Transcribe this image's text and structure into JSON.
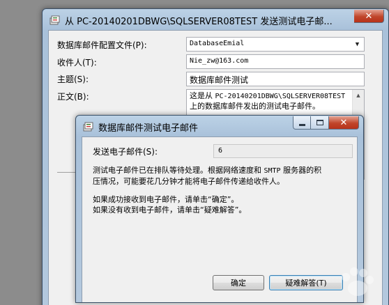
{
  "back_window": {
    "title": "从 PC-20140201DBWG\\SQLSERVER08TEST 发送测试电子邮...",
    "profile_label": "数据库邮件配置文件(P):",
    "profile_value": "DatabaseEmial",
    "to_label": "收件人(T):",
    "to_value": "Nie_zw@163.com",
    "subject_label": "主题(S):",
    "subject_value": "数据库邮件测试",
    "body_label": "正文(B):",
    "body_line1_prefix": "这是从 ",
    "body_line1_server": "PC-20140201DBWG\\SQLSERVER08TEST",
    "body_line2": "上的数据库邮件发出的测试电子邮件。"
  },
  "front_window": {
    "title": "数据库邮件测试电子邮件",
    "sent_label": "发送电子邮件(S):",
    "sent_value": "6",
    "msg1_a": "测试电子邮件已在排队等待处理。根据网络速度和 ",
    "msg1_smtp": "SMTP",
    "msg1_b": " 服务器的积",
    "msg1_c": "压情况，可能要花几分钟才能将电子邮件传递给收件人。",
    "msg2_line1": "如果成功接收到电子邮件，请单击“确定”。",
    "msg2_line2": "如果没有收到电子邮件，请单击“疑难解答”。",
    "ok_button": "确定",
    "troubleshoot_button": "疑难解答(T)"
  },
  "colors": {
    "titlebar": "#b4c9de",
    "close_button": "#c0452a",
    "dialog_bg": "#f0f0f0",
    "desktop": "#8c8c8c"
  }
}
